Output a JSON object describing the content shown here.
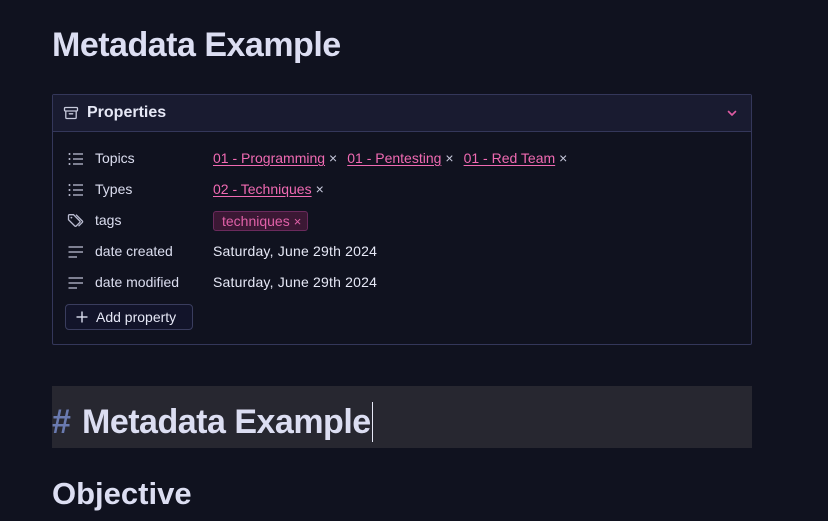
{
  "page": {
    "title": "Metadata Example"
  },
  "properties": {
    "header_label": "Properties",
    "rows": [
      {
        "name": "Topics",
        "icon": "list-icon",
        "links": [
          "01 - Programming",
          "01 - Pentesting",
          "01 - Red Team"
        ]
      },
      {
        "name": "Types",
        "icon": "list-icon",
        "links": [
          "02 - Techniques"
        ]
      },
      {
        "name": "tags",
        "icon": "tags-icon",
        "tags": [
          "techniques"
        ]
      },
      {
        "name": "date created",
        "icon": "text-lines-icon",
        "value": "Saturday, June 29th 2024"
      },
      {
        "name": "date modified",
        "icon": "text-lines-icon",
        "value": "Saturday, June 29th 2024"
      }
    ],
    "add_label": "Add property",
    "remove_glyph": "×"
  },
  "editor": {
    "active_line_marker": "#",
    "active_line_text": "Metadata Example",
    "next_heading": "Objective"
  },
  "colors": {
    "background": "#10121f",
    "link": "#f06ab2",
    "tag_bg": "#3b1834",
    "tag_text": "#e061a8",
    "header_bg": "#191b30",
    "active_line_bg": "#272730"
  }
}
